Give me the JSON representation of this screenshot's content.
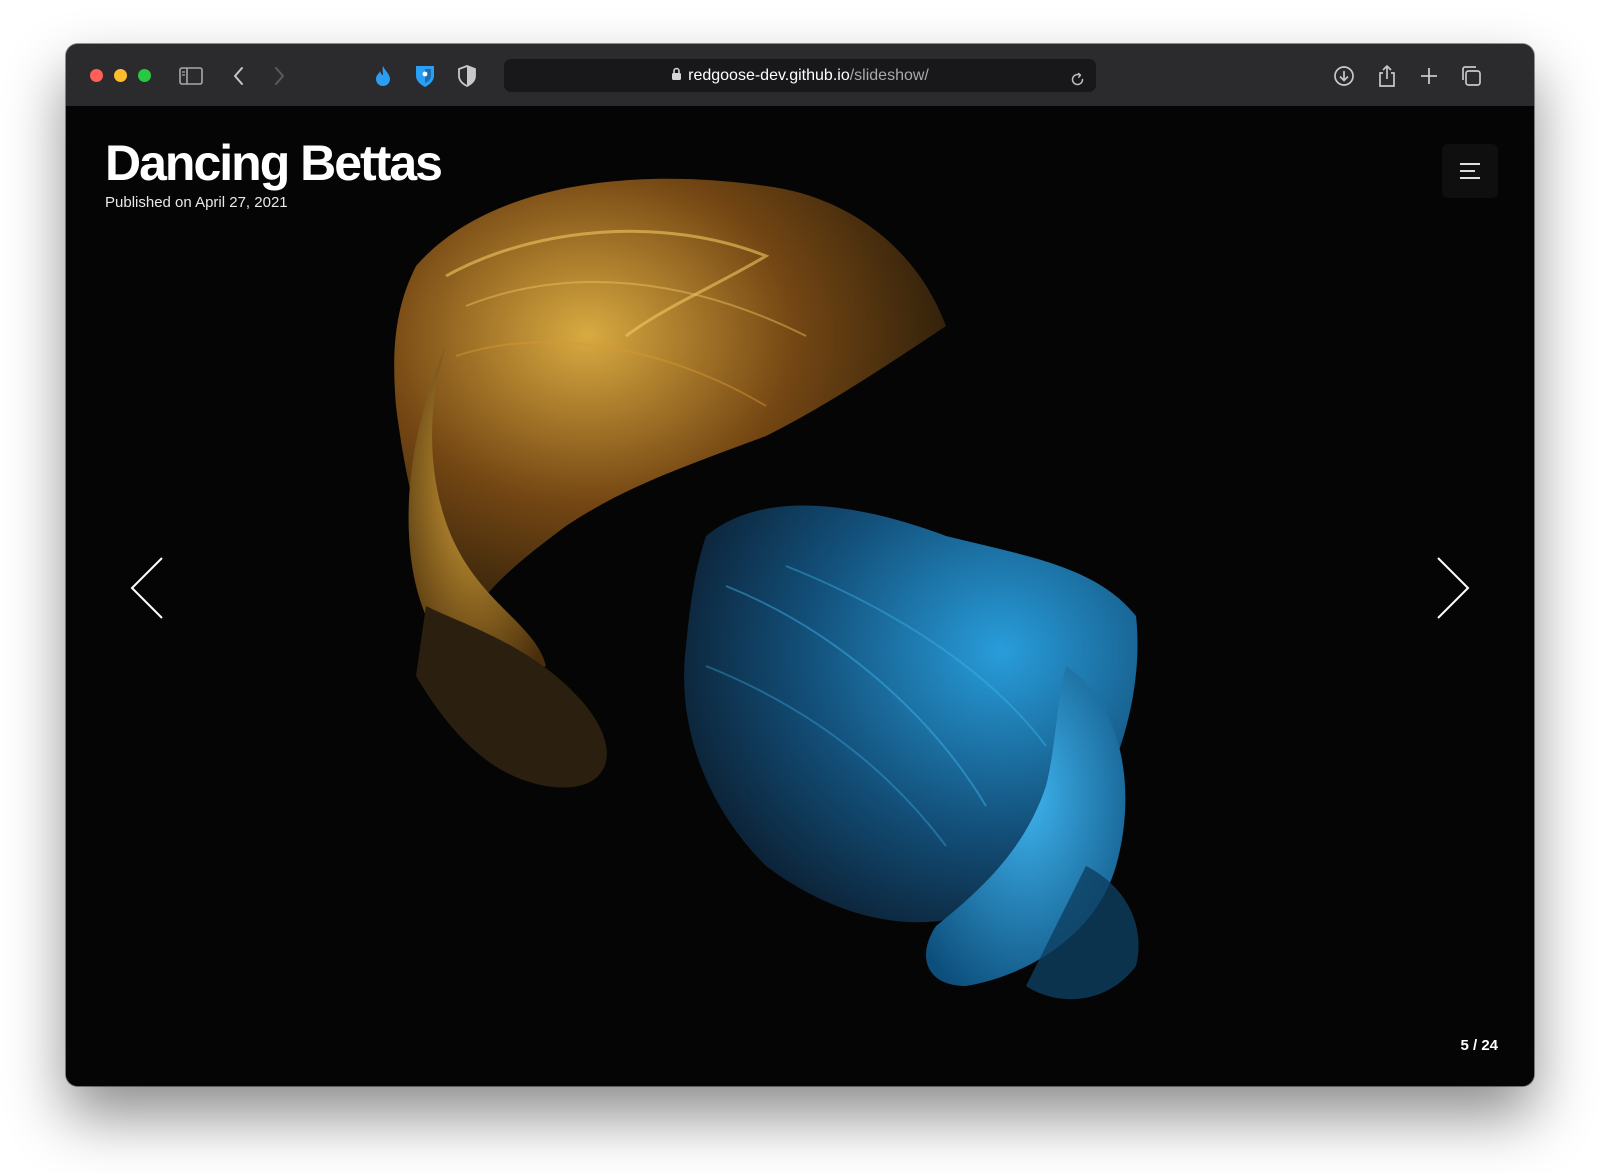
{
  "browser": {
    "url_host": "redgoose-dev.github.io",
    "url_path": "/slideshow/",
    "icons": [
      "sidebar-icon",
      "back-icon",
      "forward-icon",
      "flame-extension-icon",
      "bitwarden-icon",
      "shield-icon",
      "lock-icon",
      "reload-icon",
      "download-icon",
      "share-icon",
      "new-tab-icon",
      "tab-overview-icon"
    ]
  },
  "slideshow": {
    "title": "Dancing Bettas",
    "published": "Published on April 27, 2021",
    "counter": "5 / 24",
    "menu_icon": "menu-icon",
    "prev_icon": "chevron-left-icon",
    "next_icon": "chevron-right-icon"
  },
  "colors": {
    "toolbar": "#2b2b2d",
    "background": "#050505",
    "accent_blue": "#2a9df4"
  }
}
